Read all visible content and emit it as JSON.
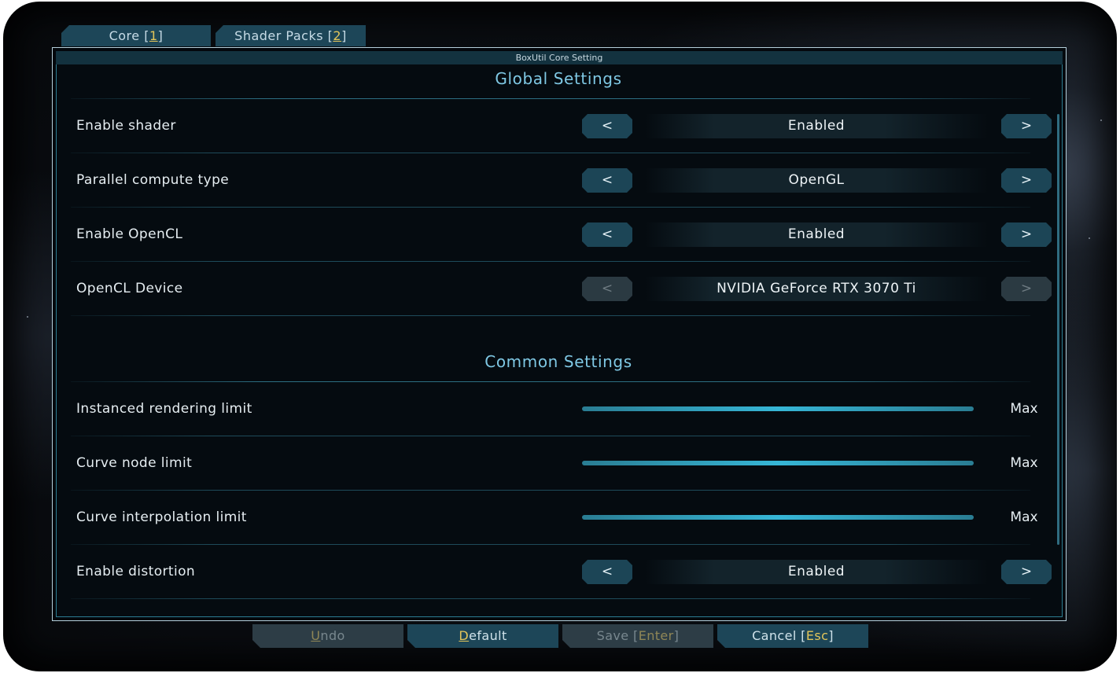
{
  "tabs": [
    {
      "label": "Core",
      "hotkey": "1"
    },
    {
      "label": "Shader Packs",
      "hotkey": "2"
    }
  ],
  "panel": {
    "title": "BoxUtil Core Setting"
  },
  "global": {
    "title": "Global Settings",
    "rows": [
      {
        "label": "Enable shader",
        "value": "Enabled",
        "prev": "<",
        "next": ">"
      },
      {
        "label": "Parallel compute type",
        "value": "OpenGL",
        "prev": "<",
        "next": ">"
      },
      {
        "label": "Enable OpenCL",
        "value": "Enabled",
        "prev": "<",
        "next": ">"
      },
      {
        "label": "OpenCL Device",
        "value": "NVIDIA GeForce RTX 3070 Ti",
        "prev": "<",
        "next": ">"
      }
    ]
  },
  "common": {
    "title": "Common Settings",
    "sliders": [
      {
        "label": "Instanced rendering limit",
        "value": "Max",
        "fraction": 1.0
      },
      {
        "label": "Curve node limit",
        "value": "Max",
        "fraction": 1.0
      },
      {
        "label": "Curve interpolation limit",
        "value": "Max",
        "fraction": 1.0
      }
    ],
    "rows": [
      {
        "label": "Enable distortion",
        "value": "Enabled",
        "prev": "<",
        "next": ">"
      }
    ]
  },
  "footer": {
    "undo": {
      "hotkey_char": "U",
      "rest": "ndo"
    },
    "default": {
      "hotkey_char": "D",
      "rest": "efault"
    },
    "save": {
      "label": "Save",
      "open": "[",
      "key": "Enter",
      "close": "]"
    },
    "cancel": {
      "label": "Cancel",
      "open": "[",
      "key": "Esc",
      "close": "]"
    }
  },
  "colors": {
    "accent": "#7fc8e4",
    "button": "#1c4556",
    "hotkey": "#e2c55a",
    "slider": "#36b6d6"
  }
}
